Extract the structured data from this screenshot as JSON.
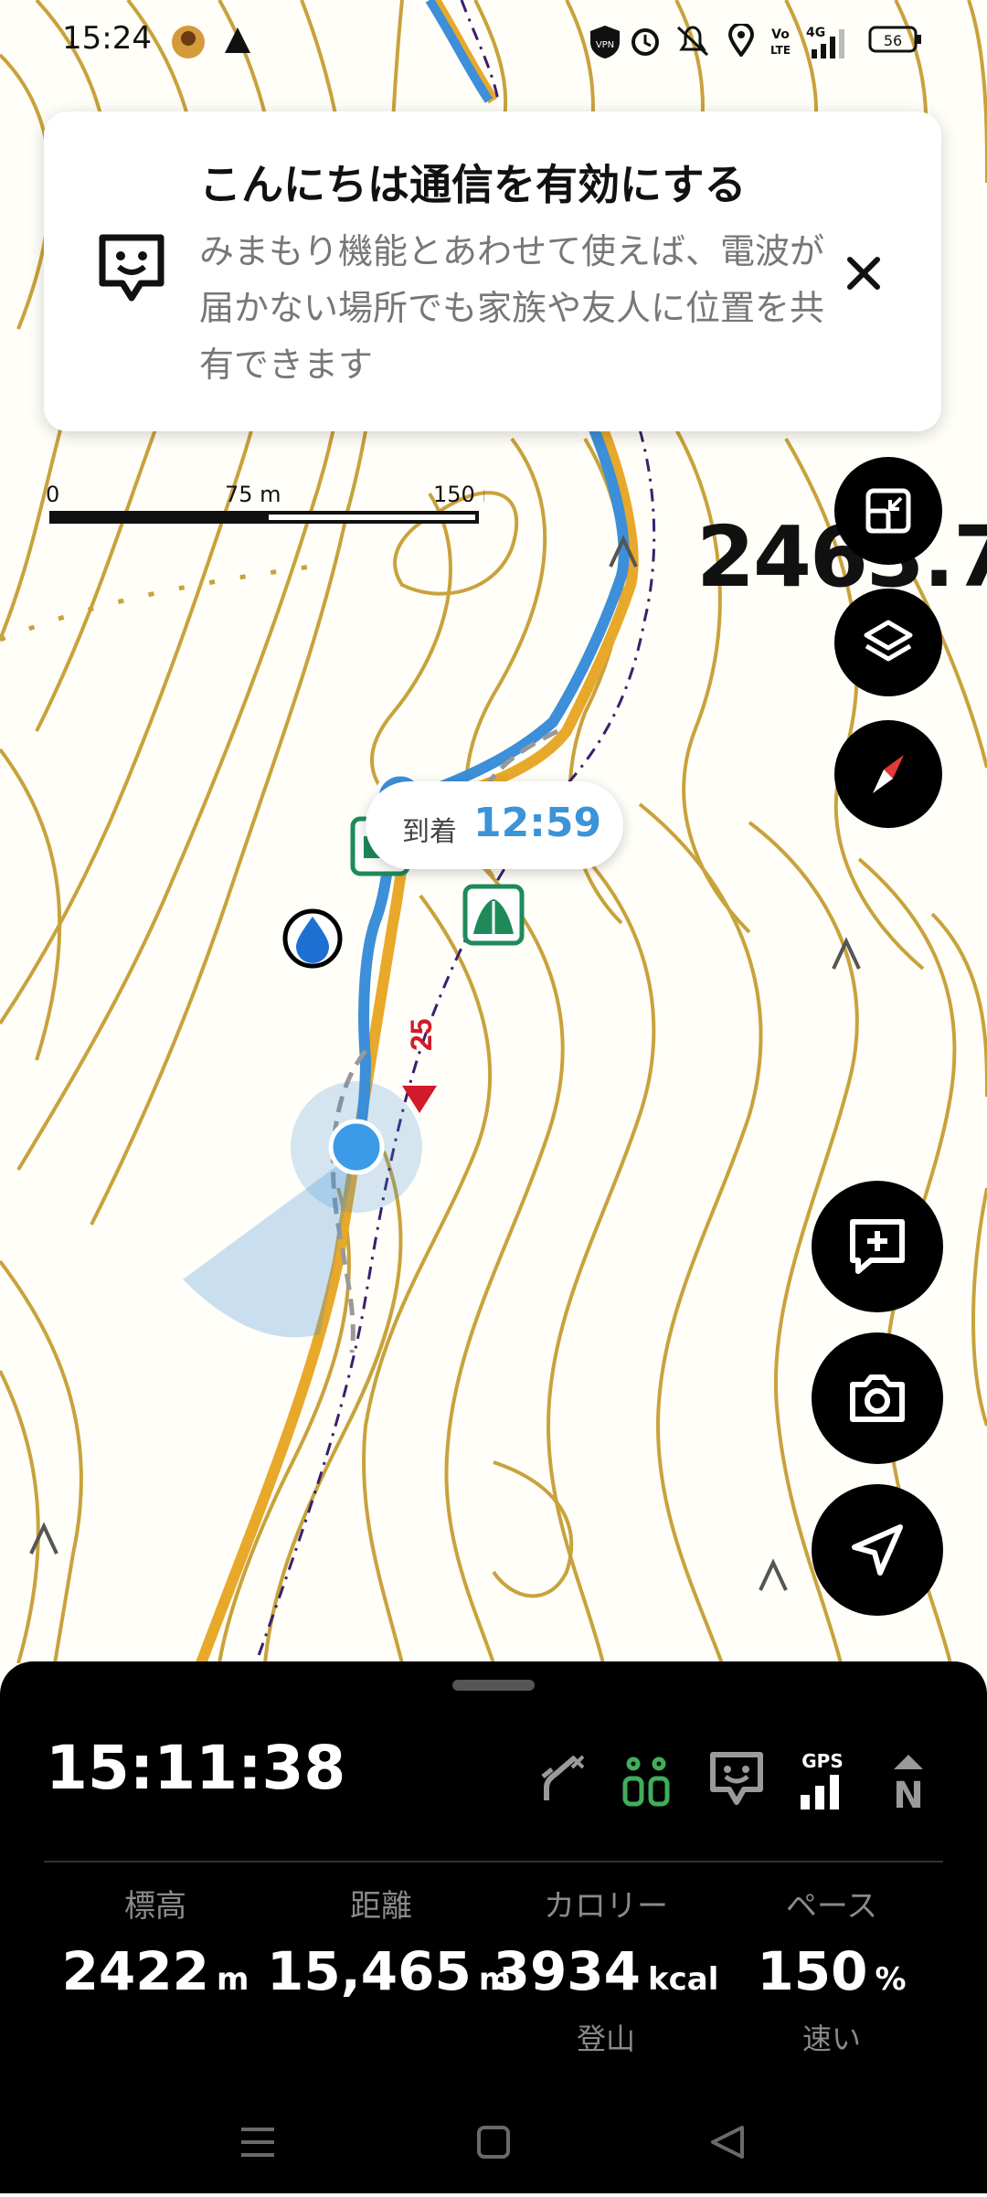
{
  "status_bar": {
    "time": "15:24",
    "battery": "56",
    "network": "4G",
    "icons": [
      "avatar-icon",
      "tent-notify-icon",
      "vpn-icon",
      "alarm-icon",
      "mute-icon",
      "location-icon",
      "volte-icon",
      "signal-icon",
      "battery-icon"
    ]
  },
  "banner": {
    "title": "こんにちは通信を有効にする",
    "body": "みまもり機能とあわせて使えば、電波が届かない場所でも家族や友人に位置を共有できます",
    "icon": "chat-face-icon",
    "close_icon": "close-icon"
  },
  "map": {
    "scale_labels": [
      "0",
      "75 m",
      "150 m"
    ],
    "elevation_label": "2463.7",
    "arrival_label": "到着",
    "arrival_time": "12:59",
    "course_marker": "25",
    "colors": {
      "contour": "#c8a23c",
      "track": "#3c8fd8",
      "route": "#e8a82a",
      "boundary": "#3a1f6e",
      "campsite": "#1e8a5a"
    }
  },
  "map_buttons": [
    "shrink-icon",
    "layers-icon",
    "compass-icon",
    "add-note-icon",
    "camera-icon",
    "navigate-icon"
  ],
  "panel": {
    "clock": "15:11:38",
    "icons": [
      "route-off-icon",
      "companions-icon",
      "chat-face-icon",
      "gps-signal-icon",
      "north-up-icon"
    ],
    "gps_label": "GPS",
    "north_label": "N",
    "stats": [
      {
        "label": "標高",
        "value": "2422",
        "unit": "m",
        "sub": ""
      },
      {
        "label": "距離",
        "value": "15,465",
        "unit": "m",
        "sub": ""
      },
      {
        "label": "カロリー",
        "value": "3934",
        "unit": "kcal",
        "sub": "登山"
      },
      {
        "label": "ペース",
        "value": "150",
        "unit": "%",
        "sub": "速い"
      }
    ]
  },
  "nav_bar": [
    "menu-icon",
    "home-icon",
    "back-icon"
  ]
}
